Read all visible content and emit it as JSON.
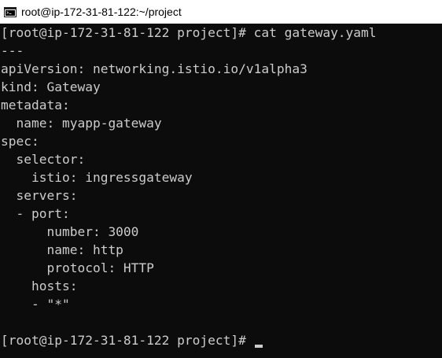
{
  "window": {
    "title": "root@ip-172-31-81-122:~/project",
    "icon": "terminal-icon"
  },
  "terminal": {
    "lines": [
      "[root@ip-172-31-81-122 project]# cat gateway.yaml",
      "---",
      "apiVersion: networking.istio.io/v1alpha3",
      "kind: Gateway",
      "metadata:",
      "  name: myapp-gateway",
      "spec:",
      "  selector:",
      "    istio: ingressgateway",
      "  servers:",
      "  - port:",
      "      number: 3000",
      "      name: http",
      "      protocol: HTTP",
      "    hosts:",
      "    - \"*\"",
      "",
      "[root@ip-172-31-81-122 project]# "
    ]
  },
  "colors": {
    "background": "#0c0c0c",
    "foreground": "#cccccc",
    "titlebar": "#ffffff"
  }
}
